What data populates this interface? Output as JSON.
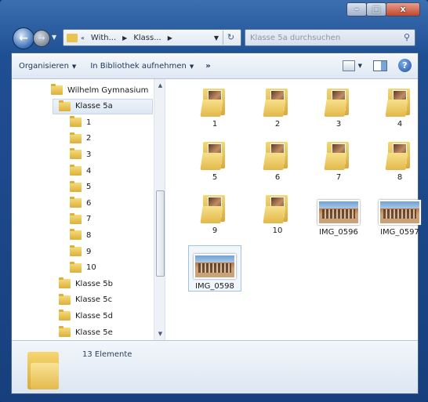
{
  "window": {
    "buttons": {
      "minimize": "–",
      "maximize": "□",
      "close": "x"
    }
  },
  "nav": {
    "breadcrumbs": [
      "With...",
      "Klass..."
    ],
    "search_placeholder": "Klasse 5a durchsuchen"
  },
  "toolbar": {
    "organize": "Organisieren",
    "include_library": "In Bibliothek aufnehmen",
    "more": "»"
  },
  "tree": {
    "items": [
      {
        "label": "Wilhelm Gymnasium",
        "level": 0
      },
      {
        "label": "Klasse 5a",
        "level": 1,
        "selected": true
      },
      {
        "label": "1",
        "level": 2
      },
      {
        "label": "2",
        "level": 2
      },
      {
        "label": "3",
        "level": 2
      },
      {
        "label": "4",
        "level": 2
      },
      {
        "label": "5",
        "level": 2
      },
      {
        "label": "6",
        "level": 2
      },
      {
        "label": "7",
        "level": 2
      },
      {
        "label": "8",
        "level": 2
      },
      {
        "label": "9",
        "level": 2
      },
      {
        "label": "10",
        "level": 2
      },
      {
        "label": "Klasse 5b",
        "level": 1
      },
      {
        "label": "Klasse 5c",
        "level": 1
      },
      {
        "label": "Klasse 5d",
        "level": 1
      },
      {
        "label": "Klasse 5e",
        "level": 1
      }
    ]
  },
  "content": {
    "items": [
      {
        "label": "1",
        "type": "folder"
      },
      {
        "label": "2",
        "type": "folder"
      },
      {
        "label": "3",
        "type": "folder"
      },
      {
        "label": "4",
        "type": "folder"
      },
      {
        "label": "5",
        "type": "folder"
      },
      {
        "label": "6",
        "type": "folder"
      },
      {
        "label": "7",
        "type": "folder"
      },
      {
        "label": "8",
        "type": "folder"
      },
      {
        "label": "9",
        "type": "folder"
      },
      {
        "label": "10",
        "type": "folder"
      },
      {
        "label": "IMG_0596",
        "type": "image"
      },
      {
        "label": "IMG_0597",
        "type": "image"
      },
      {
        "label": "IMG_0598",
        "type": "image",
        "selected": true
      }
    ]
  },
  "details": {
    "count_text": "13 Elemente"
  }
}
